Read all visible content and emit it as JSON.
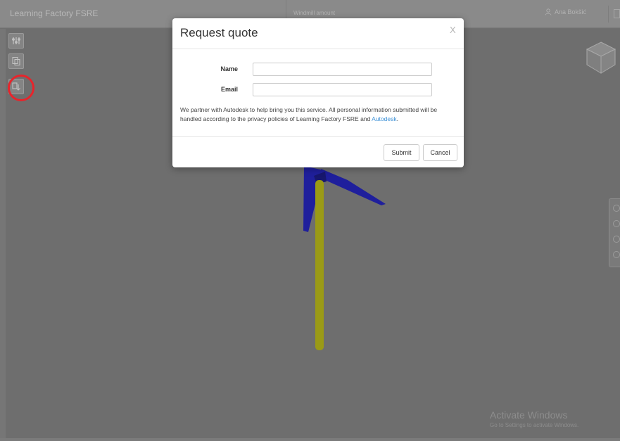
{
  "header": {
    "app_title": "Learning Factory FSRE",
    "model_name": "Windmill amount",
    "user_name": "Ana Bokšić"
  },
  "toolbar": {
    "icons": [
      "model-tree-icon",
      "document-browser-icon",
      "export-download-icon"
    ]
  },
  "modal": {
    "title": "Request quote",
    "close_label": "X",
    "name_label": "Name",
    "name_value": "",
    "email_label": "Email",
    "email_value": "",
    "notice_text": "We partner with Autodesk to help bring you this service. All personal information submitted will be handled according to the privacy policies of Learning Factory FSRE and ",
    "notice_link": "Autodesk",
    "notice_end": ".",
    "submit_label": "Submit",
    "cancel_label": "Cancel"
  },
  "watermark": {
    "title": "Activate Windows",
    "subtitle": "Go to Settings to activate Windows."
  },
  "colors": {
    "blade": "#1f1f9c",
    "pole": "#9a9a16",
    "highlight": "#e8242b",
    "link": "#3a8fd6"
  }
}
